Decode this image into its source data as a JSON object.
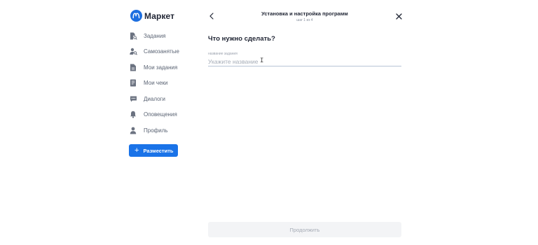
{
  "brand": {
    "name": "Маркет",
    "accent": "#1a73e8"
  },
  "sidebar": {
    "items": [
      {
        "label": "Задания",
        "icon": "tasks-search-icon"
      },
      {
        "label": "Самозанятые",
        "icon": "person-search-icon"
      },
      {
        "label": "Мои задания",
        "icon": "document-icon"
      },
      {
        "label": "Мои чеки",
        "icon": "receipt-icon"
      },
      {
        "label": "Диалоги",
        "icon": "chat-icon"
      },
      {
        "label": "Оповещения",
        "icon": "bell-icon"
      },
      {
        "label": "Профиль",
        "icon": "user-icon"
      }
    ],
    "post_button": {
      "label": "Разместить",
      "icon": "plus-icon"
    }
  },
  "header": {
    "title": "Установка и настройка программ",
    "step": "шаг 1 из 4"
  },
  "form": {
    "question": "Что нужно сделать?",
    "field_label": "название задания",
    "field_placeholder": "Укажите название",
    "field_value": ""
  },
  "footer": {
    "continue_label": "Продолжить"
  }
}
